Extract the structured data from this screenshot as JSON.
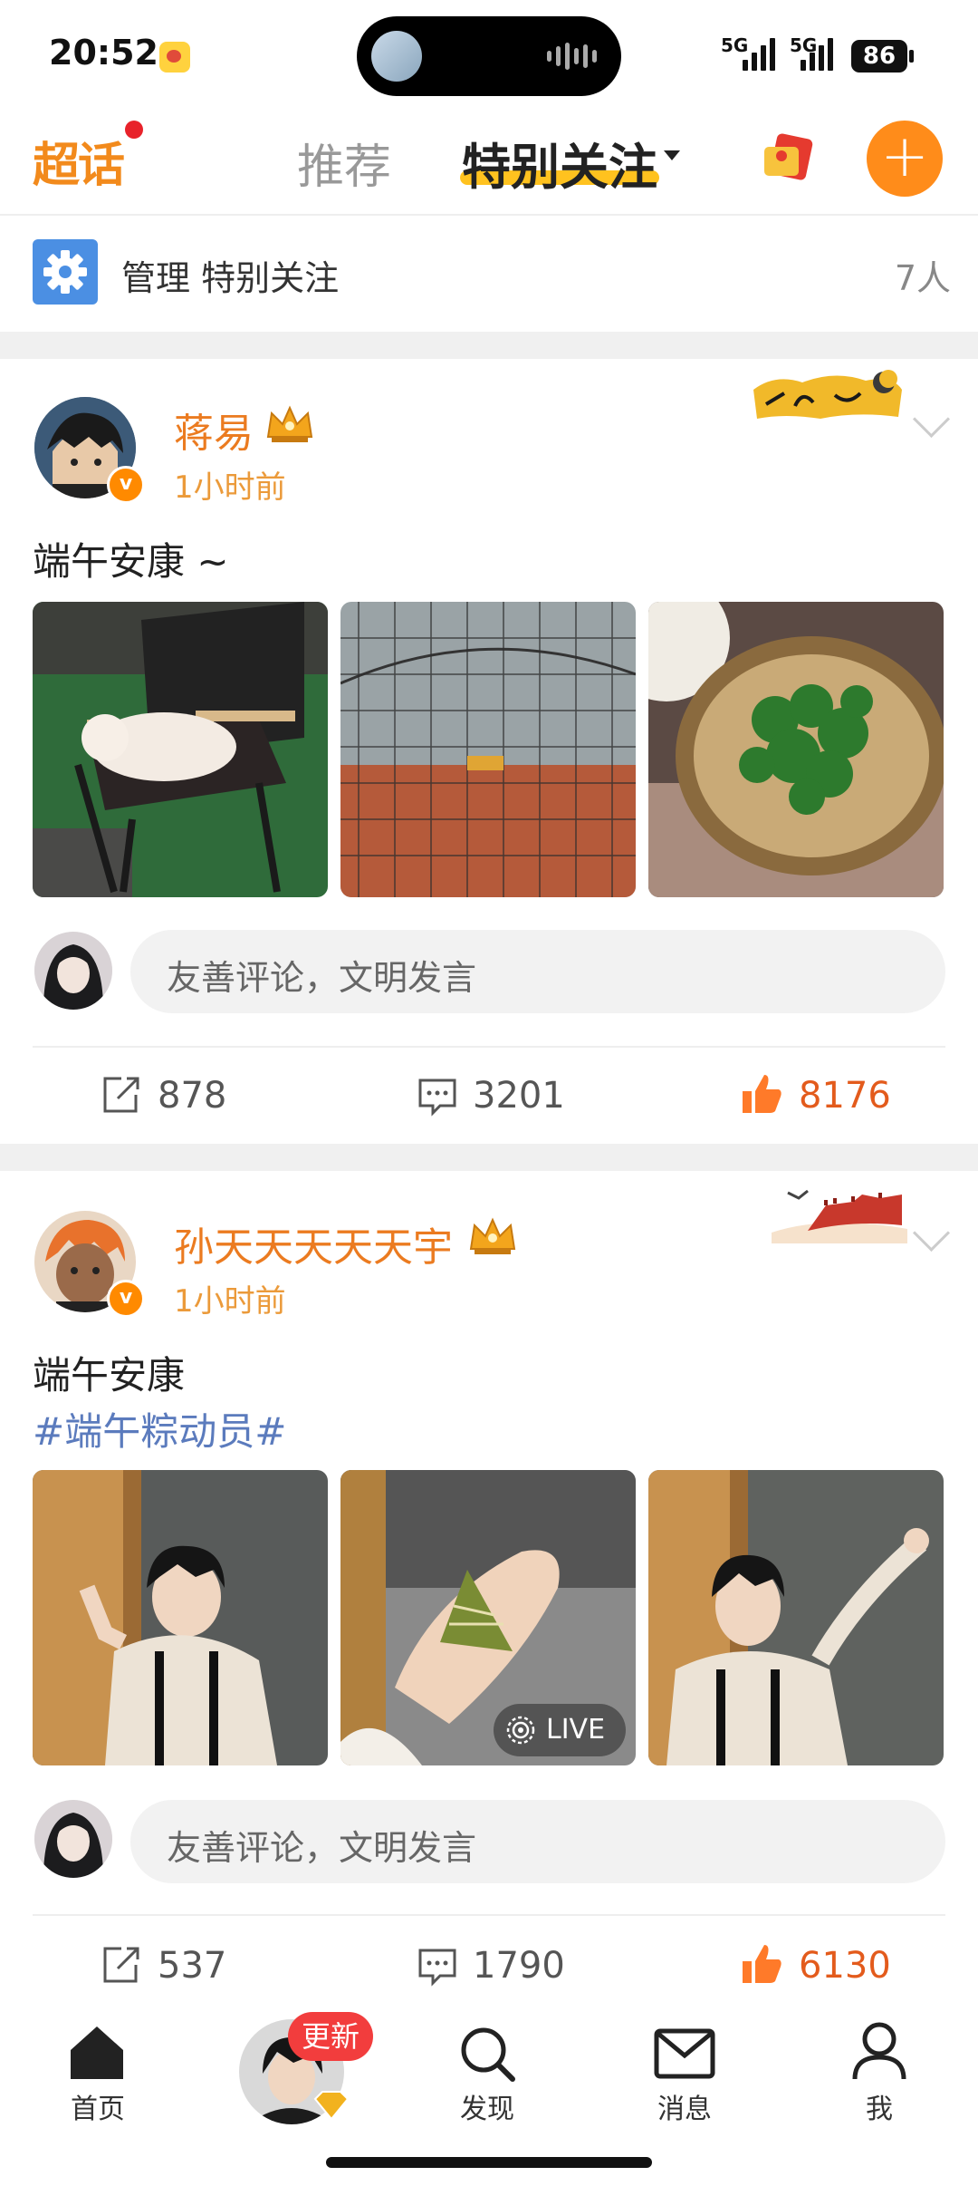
{
  "status_bar": {
    "time": "20:52",
    "network_1": "5G",
    "network_2": "5G",
    "battery": "86"
  },
  "top_nav": {
    "logo": "超话",
    "tabs": [
      {
        "label": "推荐"
      },
      {
        "label": "特别关注"
      }
    ]
  },
  "manage_bar": {
    "label": "管理 特别关注",
    "count": "7人"
  },
  "posts": [
    {
      "author": "蒋易",
      "time": "1小时前",
      "text": "端午安康 ~",
      "comment_placeholder": "友善评论，文明发言",
      "reposts": "878",
      "comments": "3201",
      "likes": "8176"
    },
    {
      "author": "孙天天天天天宇",
      "time": "1小时前",
      "text": "端午安康",
      "tag": "#端午粽动员#",
      "live_label": "LIVE",
      "comment_placeholder": "友善评论，文明发言",
      "reposts": "537",
      "comments": "1790",
      "likes": "6130"
    }
  ],
  "bottom_nav": {
    "items": [
      {
        "label": "首页"
      },
      {
        "label": ""
      },
      {
        "label": "发现"
      },
      {
        "label": "消息"
      },
      {
        "label": "我"
      }
    ],
    "update_badge": "更新"
  },
  "colors": {
    "brand_orange": "#ff8c1a",
    "username_orange": "#eb7b20",
    "like_red": "#e35b1c",
    "tag_blue": "#5b7bbd"
  }
}
